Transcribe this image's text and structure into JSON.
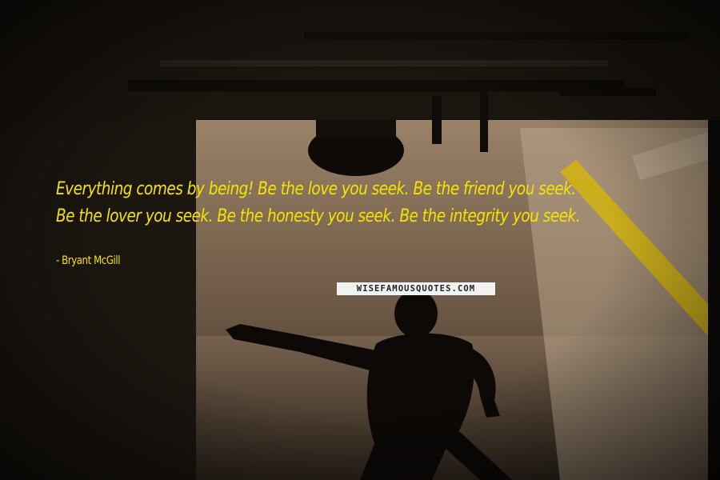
{
  "quote": {
    "text": "Everything comes by being! Be the love you seek. Be the friend you seek. Be the lover you seek. Be the honesty you seek. Be the integrity you seek.",
    "author_line": "- Bryant McGill"
  },
  "watermark": {
    "text": "WISEFAMOUSQUOTES.COM"
  },
  "colors": {
    "quote_text": "#f5e300",
    "author_text": "#f5e300",
    "background_dark": "#1a1510",
    "background_light": "#8a7258"
  }
}
